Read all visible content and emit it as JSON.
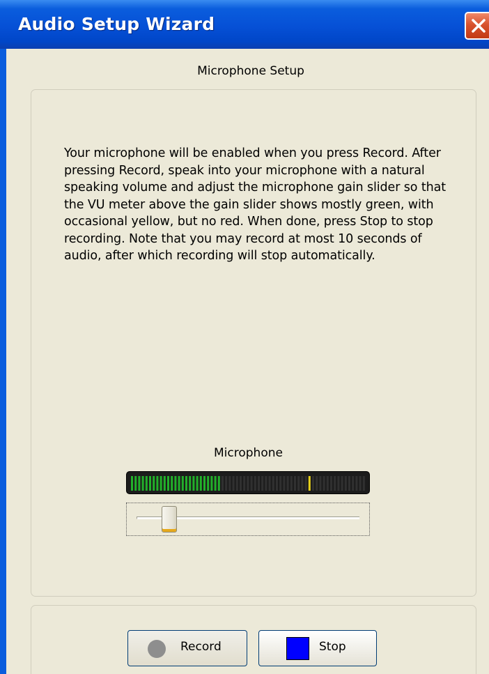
{
  "window": {
    "title": "Audio Setup Wizard"
  },
  "page": {
    "section_title": "Microphone Setup",
    "instructions": "Your microphone will be enabled when you press Record. After pressing Record, speak into your microphone with a natural speaking volume and adjust the microphone gain slider so that the VU meter above the gain slider shows mostly green, with occasional yellow, but no red.  When done, press Stop to stop recording.  Note that you may record at most 10 seconds of audio, after which recording will stop automatically."
  },
  "microphone": {
    "label": "Microphone",
    "vu_meter": {
      "level_fraction": 0.38,
      "peak_fraction": 0.76,
      "active_color": "#22b02a",
      "peak_color": "#e8d21a",
      "inactive_color": "#303030"
    },
    "gain_slider": {
      "value_fraction": 0.12
    }
  },
  "buttons": {
    "record_label": "Record",
    "stop_label": "Stop"
  },
  "colors": {
    "titlebar": "#0650d6",
    "background": "#ece9d8",
    "stop_icon": "#0000ff",
    "record_icon": "#8e8e8e"
  }
}
